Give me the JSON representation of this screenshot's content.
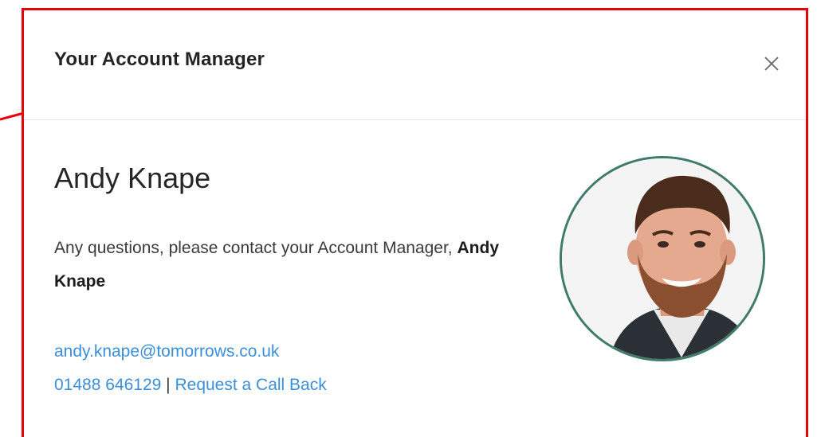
{
  "modal": {
    "title": "Your Account Manager",
    "close_icon": "close-icon"
  },
  "manager": {
    "name": "Andy Knape",
    "intro_prefix": "Any questions, please contact your Account Manager,",
    "intro_name": "Andy Knape",
    "email": "andy.knape@tomorrows.co.uk",
    "phone": "01488 646129",
    "separator": "|",
    "callback_label": "Request a Call Back",
    "avatar_icon": "profile-photo"
  },
  "colors": {
    "highlight": "#e8000b",
    "link": "#3b8fd9",
    "avatar_ring": "#3f7a6b"
  }
}
